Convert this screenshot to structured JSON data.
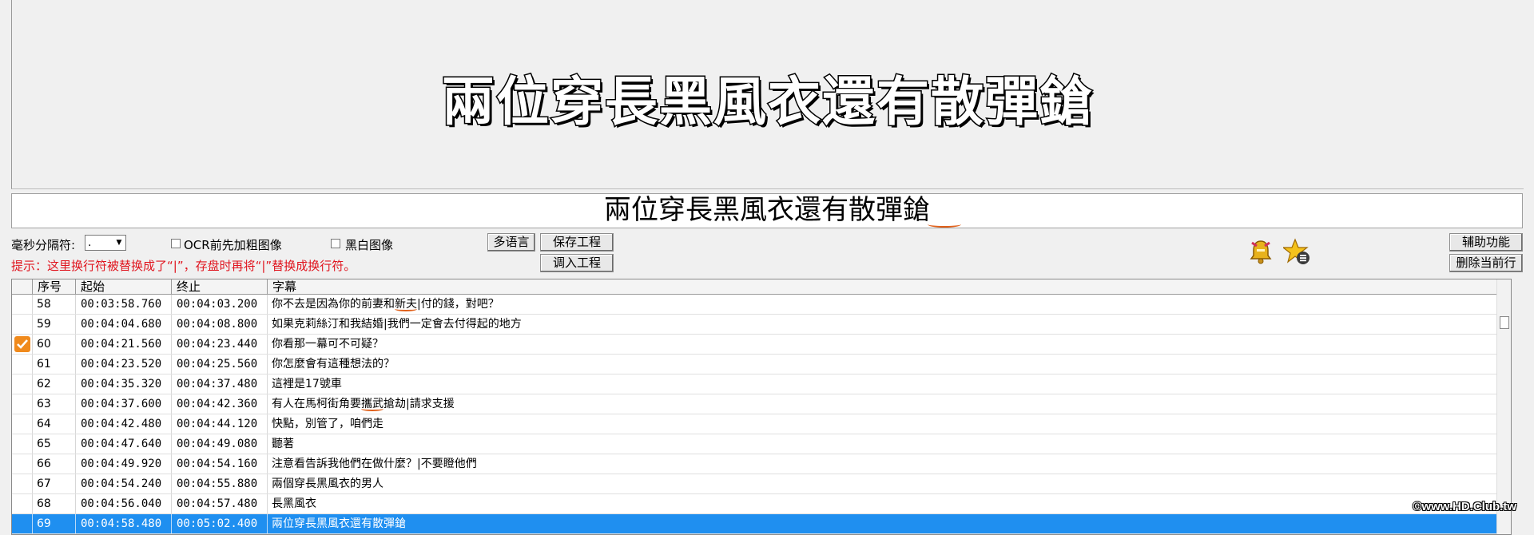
{
  "preview": {
    "subtitle_overlay": "兩位穿長黑風衣還有散彈鎗"
  },
  "edit_line": {
    "text": "兩位穿長黑風衣還有散彈鎗"
  },
  "controls": {
    "ms_separator_label": "毫秒分隔符:",
    "ms_separator_value": ".",
    "ocr_bold_label": "OCR前先加粗图像",
    "bw_label": "黑白图像",
    "multilang_button": "多语言",
    "save_project_button": "保存工程",
    "load_project_button": "调入工程",
    "assist_button": "辅助功能",
    "delete_row_button": "删除当前行",
    "hint": "提示：这里换行符被替换成了“|”，存盘时再将“|”替换成换行符。"
  },
  "table": {
    "headers": {
      "index": "序号",
      "start": "起始",
      "end": "终止",
      "text": "字幕"
    },
    "rows": [
      {
        "idx": "58",
        "start": "00:03:58.760",
        "end": "00:04:03.200",
        "text": "你不去是因為你的前妻和新夫|付的錢，對吧？"
      },
      {
        "idx": "59",
        "start": "00:04:04.680",
        "end": "00:04:08.800",
        "text": "如果克莉絲汀和我結婚|我們一定會去付得起的地方"
      },
      {
        "idx": "60",
        "start": "00:04:21.560",
        "end": "00:04:23.440",
        "text": "你看那一幕可不可疑？"
      },
      {
        "idx": "61",
        "start": "00:04:23.520",
        "end": "00:04:25.560",
        "text": "你怎麼會有這種想法的？"
      },
      {
        "idx": "62",
        "start": "00:04:35.320",
        "end": "00:04:37.480",
        "text": "這裡是17號車"
      },
      {
        "idx": "63",
        "start": "00:04:37.600",
        "end": "00:04:42.360",
        "text": "有人在馬柯街角要攜武搶劫|請求支援"
      },
      {
        "idx": "64",
        "start": "00:04:42.480",
        "end": "00:04:44.120",
        "text": "快點，別管了，咱們走"
      },
      {
        "idx": "65",
        "start": "00:04:47.640",
        "end": "00:04:49.080",
        "text": "聽著"
      },
      {
        "idx": "66",
        "start": "00:04:49.920",
        "end": "00:04:54.160",
        "text": "注意看告訴我他們在做什麼？|不要瞪他們"
      },
      {
        "idx": "67",
        "start": "00:04:54.240",
        "end": "00:04:55.880",
        "text": "兩個穿長黑風衣的男人"
      },
      {
        "idx": "68",
        "start": "00:04:56.040",
        "end": "00:04:57.480",
        "text": "長黑風衣"
      },
      {
        "idx": "69",
        "start": "00:04:58.480",
        "end": "00:05:02.400",
        "text": "兩位穿長黑風衣還有散彈鎗"
      }
    ]
  },
  "watermark": "©www.HD.Club.tw"
}
